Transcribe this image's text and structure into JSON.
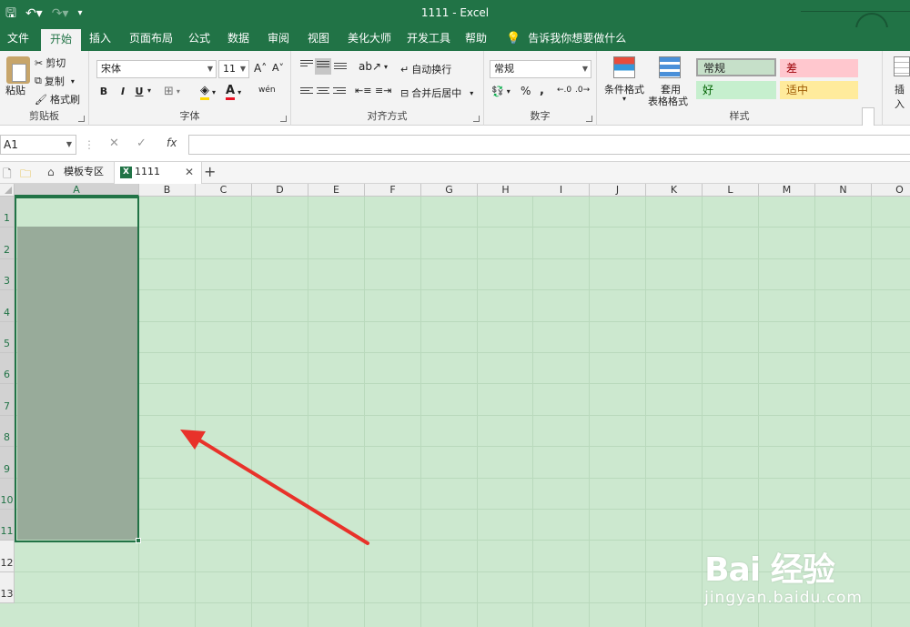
{
  "titlebar": {
    "title": "1111  -  Excel",
    "qat": [
      "save-icon",
      "undo-icon",
      "redo-icon",
      "customize-icon"
    ]
  },
  "tabs": [
    "文件",
    "开始",
    "插入",
    "页面布局",
    "公式",
    "数据",
    "审阅",
    "视图",
    "美化大师",
    "开发工具",
    "帮助"
  ],
  "active_tab": "开始",
  "tell_me": "告诉我你想要做什么",
  "ribbon": {
    "clipboard": {
      "paste": "粘贴",
      "cut": "剪切",
      "copy": "复制",
      "format_painter": "格式刷",
      "label": "剪贴板"
    },
    "font": {
      "font_name": "宋体",
      "font_size": "11",
      "bold": "B",
      "italic": "I",
      "underline": "U",
      "phonetic": "wén",
      "label": "字体"
    },
    "alignment": {
      "wrap": "自动换行",
      "merge": "合并后居中",
      "label": "对齐方式"
    },
    "number": {
      "format": "常规",
      "percent": "%",
      "comma": ",",
      "label": "数字"
    },
    "styles": {
      "conditional": "条件格式",
      "table": [
        "套用",
        "表格格式"
      ],
      "normal": "常规",
      "bad": "差",
      "good": "好",
      "neutral": "适中",
      "label": "样式"
    },
    "cells": {
      "insert": "插入"
    }
  },
  "formula_bar": {
    "name_box": "A1",
    "fx": "fx",
    "value": ""
  },
  "doc_tabs": {
    "templates": "模板专区",
    "file": "1111"
  },
  "grid": {
    "columns": [
      "A",
      "B",
      "C",
      "D",
      "E",
      "F",
      "G",
      "H",
      "I",
      "J",
      "K",
      "L",
      "M",
      "N",
      "O"
    ],
    "rows": [
      "1",
      "2",
      "3",
      "4",
      "5",
      "6",
      "7",
      "8",
      "9",
      "10",
      "11",
      "12",
      "13"
    ],
    "selected_range": "A1:A11"
  },
  "watermark": {
    "main": "Bai 经验",
    "sub": "jingyan.baidu.com"
  },
  "colors": {
    "excel_green": "#217346",
    "sheet_bg": "#cce8cf",
    "selection_fill": "#98ab9a",
    "arrow": "#e8322a"
  }
}
